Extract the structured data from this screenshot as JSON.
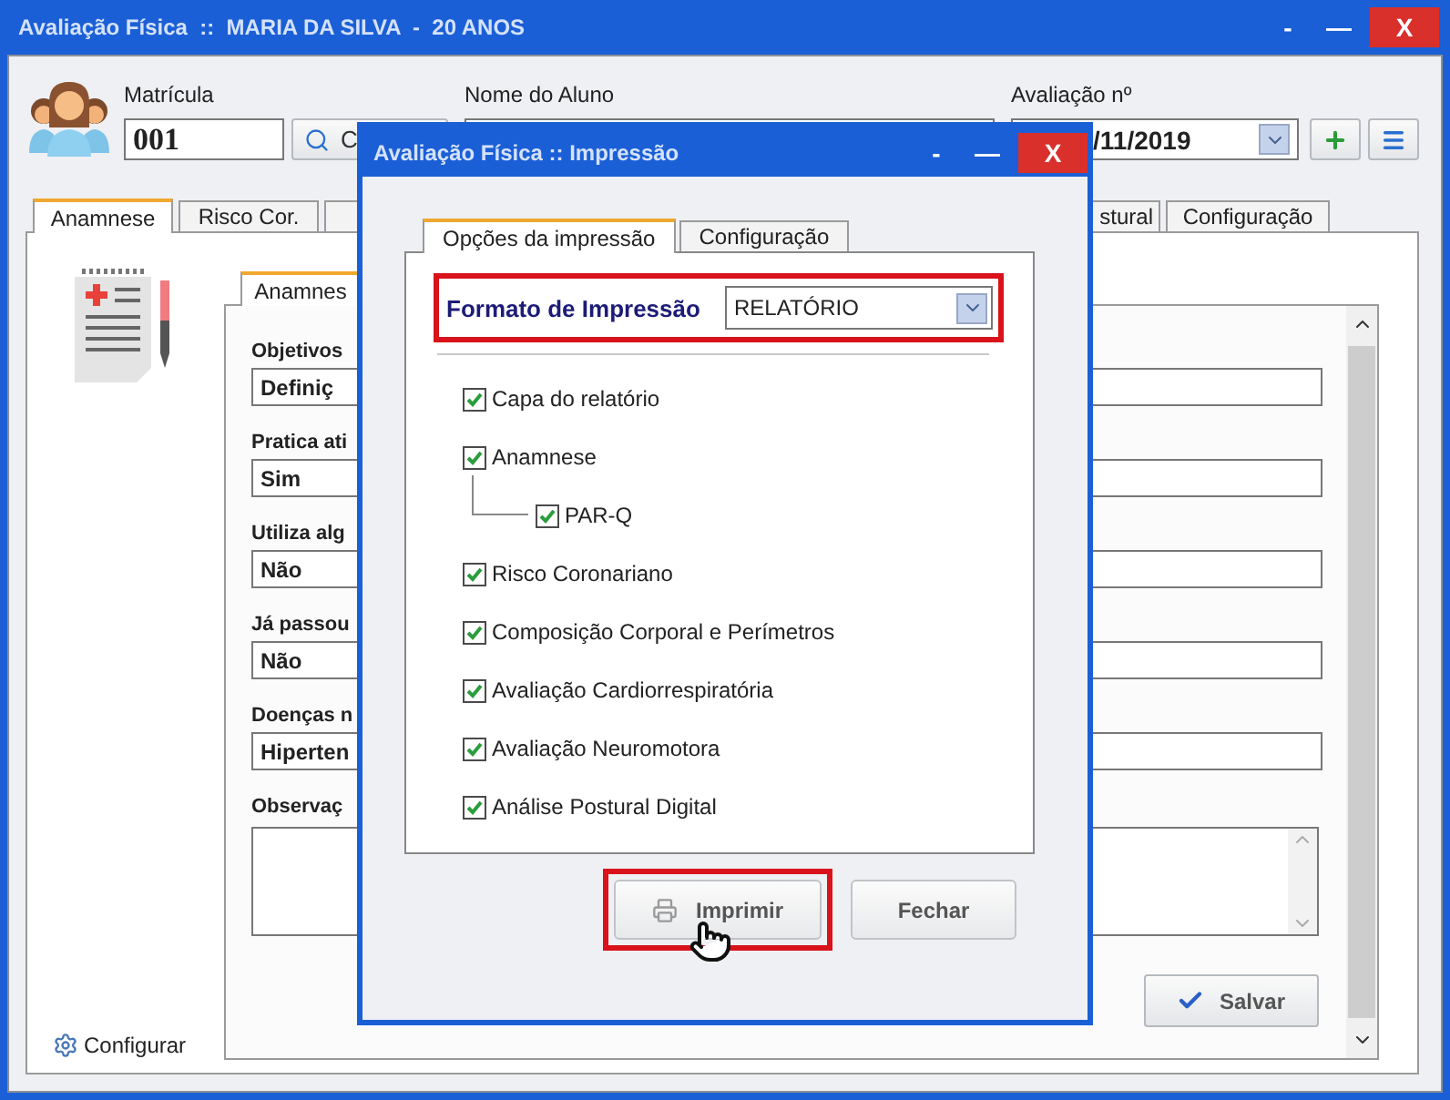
{
  "window": {
    "title": "Avaliação Física  ::  MARIA DA SILVA  -  20 ANOS",
    "controls": [
      {
        "kind": "minimize",
        "label": "-"
      },
      {
        "kind": "maximize",
        "label": "—"
      },
      {
        "kind": "close",
        "label": "X"
      }
    ]
  },
  "header": {
    "registration": {
      "label": "Matrícula",
      "value": "001"
    },
    "search_button": {
      "label": "C"
    },
    "student_name": {
      "label": "Nome do Aluno"
    },
    "evaluation": {
      "label": "Avaliação nº",
      "value": "/11/2019"
    }
  },
  "tabs": [
    {
      "label": "Anamnese",
      "selected": true
    },
    {
      "label": "Risco Cor.",
      "selected": false
    },
    {
      "selected": false
    },
    {
      "label": "stural",
      "selected": false
    },
    {
      "label": "Configuração",
      "selected": false
    }
  ],
  "sub_tab": {
    "label": "Anamnes",
    "selected": true
  },
  "fields": [
    {
      "label": "Objetivos",
      "value": "Definiç"
    },
    {
      "label": "Pratica ati",
      "value": "Sim"
    },
    {
      "label": "Utiliza alg",
      "value": "Não"
    },
    {
      "label": "Já passou",
      "value": "Não"
    },
    {
      "label": "Doenças n",
      "value": "Hiperten"
    }
  ],
  "notes": {
    "label": "Observaç"
  },
  "configure_link": {
    "label": "Configurar"
  },
  "save_button": {
    "label": "Salvar"
  },
  "dialog": {
    "title": "Avaliação Física :: Impressão",
    "controls": [
      {
        "kind": "minimize",
        "label": "-"
      },
      {
        "kind": "maximize",
        "label": "—"
      },
      {
        "kind": "close",
        "label": "X"
      }
    ],
    "tabs": [
      {
        "label": "Opções da impressão",
        "selected": true
      },
      {
        "label": "Configuração",
        "selected": false
      }
    ],
    "format": {
      "label": "Formato de Impressão",
      "value": "RELATÓRIO",
      "highlighted": true
    },
    "options": [
      {
        "label": "Capa do relatório",
        "checked": true
      },
      {
        "label": "Anamnese",
        "checked": true,
        "children": [
          {
            "label": "PAR-Q",
            "checked": true
          }
        ]
      },
      {
        "label": "Risco Coronariano",
        "checked": true
      },
      {
        "label": "Composição Corporal e Perímetros",
        "checked": true
      },
      {
        "label": "Avaliação Cardiorrespiratória",
        "checked": true
      },
      {
        "label": "Avaliação Neuromotora",
        "checked": true
      },
      {
        "label": "Análise Postural Digital",
        "checked": true
      }
    ],
    "buttons": [
      {
        "kind": "print",
        "label": "Imprimir",
        "highlighted": true
      },
      {
        "kind": "close",
        "label": "Fechar",
        "highlighted": false
      }
    ]
  }
}
